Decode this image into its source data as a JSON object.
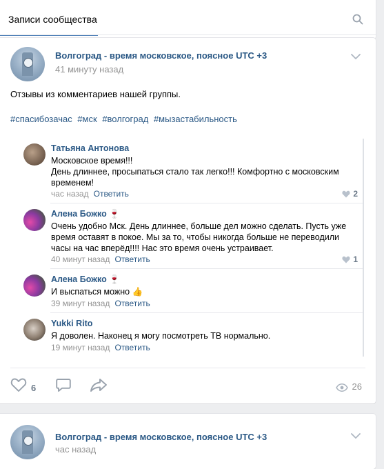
{
  "tabs": {
    "active_label": "Записи сообщества",
    "search_icon": "search-icon"
  },
  "colors": {
    "link": "#2a5885",
    "muted": "#939393",
    "tab_underline": "#5181b8",
    "background": "#edeef0"
  },
  "post1": {
    "group_name": "Волгоград - время московское, поясное UTC +3",
    "time": "41 минуту назад",
    "text": "Отзывы из комментариев нашей группы.",
    "hashtags": [
      "#спасибозачас",
      "#мск",
      "#волгоград",
      "#мызастабильность"
    ],
    "comments": [
      {
        "author": "Татьяна Антонова",
        "emoji": "",
        "lines": [
          "Московское время!!!",
          "День длиннее, просыпаться стало так легко!!! Комфортно с московским",
          "временем!"
        ],
        "time": "час назад",
        "reply": "Ответить",
        "likes": "2"
      },
      {
        "author": "Алена Божко",
        "emoji": "🍷",
        "lines": [
          "Очень удобно Мск. День длиннее, больше дел можно сделать. Пусть уже",
          "время оставят в покое. Мы за то, чтобы никогда больше не переводили",
          "часы на час вперёд!!!! Нас это время очень устраивает."
        ],
        "time": "40 минут назад",
        "reply": "Ответить",
        "likes": "1"
      },
      {
        "author": "Алена Божко",
        "emoji": "🍷",
        "lines": [
          "И выспаться можно 👍"
        ],
        "time": "39 минут назад",
        "reply": "Ответить",
        "likes": ""
      },
      {
        "author": "Yukki Rito",
        "emoji": "",
        "lines": [
          "Я доволен. Наконец я могу посмотреть ТВ нормально."
        ],
        "time": "19 минут назад",
        "reply": "Ответить",
        "likes": ""
      }
    ],
    "like_count": "6",
    "views": "26"
  },
  "post2": {
    "group_name": "Волгоград - время московское, поясное UTC +3",
    "time": "час назад"
  }
}
